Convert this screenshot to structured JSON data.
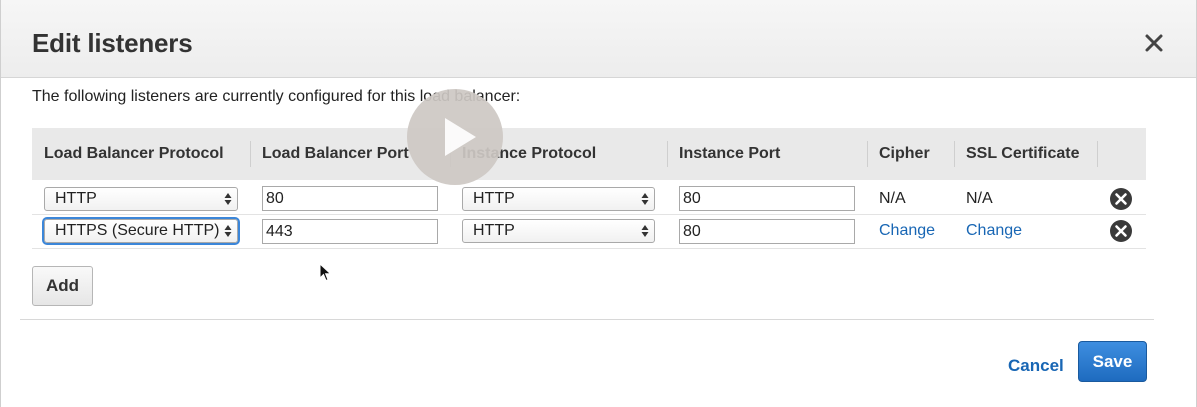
{
  "dialog": {
    "title": "Edit listeners",
    "intro": "The following listeners are currently configured for this load balancer:"
  },
  "table": {
    "headers": [
      "Load Balancer Protocol",
      "Load Balancer Port",
      "Instance Protocol",
      "Instance Port",
      "Cipher",
      "SSL Certificate"
    ],
    "rows": [
      {
        "lb_protocol": "HTTP",
        "lb_port": "80",
        "instance_protocol": "HTTP",
        "instance_port": "80",
        "cipher": "N/A",
        "ssl_certificate": "N/A"
      },
      {
        "lb_protocol": "HTTPS (Secure HTTP)",
        "lb_port": "443",
        "instance_protocol": "HTTP",
        "instance_port": "80",
        "cipher": "Change",
        "ssl_certificate": "Change"
      }
    ]
  },
  "actions": {
    "add_label": "Add",
    "cancel_label": "Cancel",
    "save_label": "Save"
  },
  "icons": {
    "close": "close-icon",
    "remove": "remove-circle-icon",
    "select_arrows": "updown-arrows-icon",
    "play": "play-icon"
  },
  "colors": {
    "link": "#1866b4",
    "primary_button": "#2a78cc",
    "header_bg": "#e9e9e9",
    "focus": "#3b86d9"
  }
}
